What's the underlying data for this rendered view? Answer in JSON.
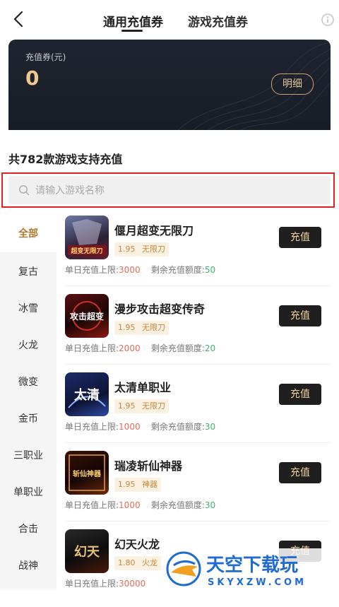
{
  "header": {
    "tabs": [
      "通用充值券",
      "游戏充值券"
    ]
  },
  "voucher_card": {
    "label": "充值券(元)",
    "value": "0",
    "detail_button": "明细"
  },
  "summary": {
    "title": "共782款游戏支持充值"
  },
  "search": {
    "placeholder": "请输入游戏名称"
  },
  "categories": [
    "全部",
    "复古",
    "冰雪",
    "火龙",
    "微变",
    "金币",
    "三职业",
    "单职业",
    "合击",
    "战神"
  ],
  "games": [
    {
      "name": "偃月超变无限刀",
      "discount": "1.95",
      "tag": "无限刀",
      "limit_label": "单日充值上限:",
      "limit": "3000",
      "remain_label": "剩余充值额度:",
      "remain": "50",
      "button": "充值"
    },
    {
      "name": "漫步攻击超变传奇",
      "discount": "1.95",
      "tag": "无限刀",
      "limit_label": "单日充值上限:",
      "limit": "2000",
      "remain_label": "剩余充值额度:",
      "remain": "20",
      "button": "充值"
    },
    {
      "name": "太清单职业",
      "discount": "1.95",
      "tag": "无限刀",
      "limit_label": "单日充值上限:",
      "limit": "1000",
      "remain_label": "剩余充值额度:",
      "remain": "30",
      "button": "充值"
    },
    {
      "name": "瑞凌斩仙神器",
      "discount": "1.95",
      "tag": "神器",
      "limit_label": "单日充值上限:",
      "limit": "1000",
      "remain_label": "剩余充值额度:",
      "remain": "30",
      "button": "充值"
    },
    {
      "name": "幻天火龙",
      "discount": "1.80",
      "tag": "火龙",
      "limit_label": "单日充值上限:",
      "limit": "30000",
      "remain_label": "",
      "remain": "",
      "button": "充值"
    }
  ],
  "thumb_text": [
    "超变无限刀",
    "攻击超变",
    "太清",
    "斩仙神器",
    "幻天"
  ],
  "watermark": {
    "cn": "天空下载玩",
    "en": "SKYXZW.COM"
  }
}
